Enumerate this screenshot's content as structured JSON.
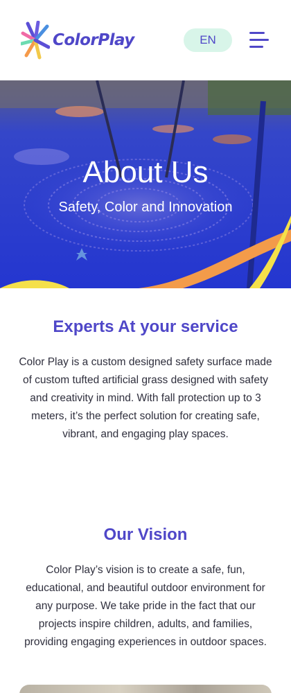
{
  "header": {
    "brand": "ColorPlay",
    "language_label": "EN"
  },
  "hero": {
    "title": "About Us",
    "subtitle": "Safety, Color and Innovation"
  },
  "sections": [
    {
      "heading": "Experts At your service",
      "body": "Color Play is a custom designed safety surface made of custom tufted artificial grass designed with safety and creativity in mind. With fall protection up to 3 meters, it’s the perfect solution for creating safe, vibrant, and engaging play spaces."
    },
    {
      "heading": "Our Vision",
      "body": "Color Play’s vision is to create a safe, fun, educational, and beautiful outdoor environment for any purpose. We take pride in the fact that our projects inspire children, adults, and families, providing engaging experiences in outdoor spaces."
    }
  ],
  "colors": {
    "brand": "#4f47c8",
    "lang_pill": "#d8f5e9",
    "hero_overlay": "#2f3ed6",
    "wave_yellow": "#f5e04a",
    "wave_orange": "#f39b4a"
  },
  "icons": {
    "logo": "burst-logo-icon",
    "menu": "hamburger-menu-icon"
  }
}
